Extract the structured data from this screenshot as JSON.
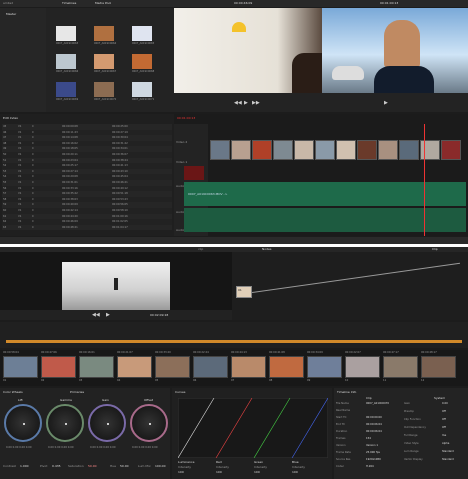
{
  "top": {
    "project_title": "ambs2",
    "tab_timelines": "Timelines",
    "tab_media_pool": "Media Pool",
    "folder_master": "Master",
    "clip_thumbs": [
      {
        "label": "0007_A019C0063",
        "color": "#e7e7e7"
      },
      {
        "label": "0007_A019C0064",
        "color": "#b07040"
      },
      {
        "label": "0007_A019C0065",
        "color": "#dfe4f0"
      },
      {
        "label": "0007_A019C0066",
        "color": "#bcc7cf"
      },
      {
        "label": "0007_A019C0067",
        "color": "#d49a70"
      },
      {
        "label": "0007_A019C0068",
        "color": "#c36a33"
      },
      {
        "label": "0007_A019C0069",
        "color": "#3b4a8a"
      },
      {
        "label": "0007_A019C0070",
        "color": "#8c6c52"
      },
      {
        "label": "0007_A019C0071",
        "color": "#cfd8e1"
      }
    ],
    "viewer_left_tc": "00:00:46:09",
    "viewer_right_tc": "00:01:00:13",
    "edit_index_title": "Edit Index",
    "edit_index_headers": [
      "#",
      "Reel",
      "V",
      "C",
      "Dur",
      "Source In",
      "Source Out",
      "Record In",
      "Record Out"
    ],
    "edit_index_rows": [
      [
        "45",
        "V1",
        "C",
        "00:00:09:08",
        "00:00:25:00"
      ],
      [
        "46",
        "V1",
        "C",
        "00:00:11:23",
        "00:00:27:19"
      ],
      [
        "47",
        "V1",
        "C",
        "00:00:14:08",
        "00:00:30:04"
      ],
      [
        "48",
        "V1",
        "C",
        "00:00:16:02",
        "00:00:31:22"
      ],
      [
        "49",
        "V1",
        "C",
        "00:00:18:05",
        "00:00:34:01"
      ],
      [
        "50",
        "V1",
        "C",
        "00:00:20:11",
        "00:00:36:07"
      ],
      [
        "51",
        "V1",
        "C",
        "00:00:23:04",
        "00:00:38:24"
      ],
      [
        "52",
        "V1",
        "C",
        "00:00:25:17",
        "00:00:41:13"
      ],
      [
        "53",
        "V1",
        "C",
        "00:00:27:14",
        "00:00:43:10"
      ],
      [
        "54",
        "V1",
        "C",
        "00:00:29:08",
        "00:00:45:04"
      ],
      [
        "55",
        "V1",
        "C",
        "00:00:31:01",
        "00:00:46:21"
      ],
      [
        "56",
        "V1",
        "C",
        "00:00:33:16",
        "00:00:49:12"
      ],
      [
        "57",
        "V1",
        "C",
        "00:00:35:22",
        "00:00:51:18"
      ],
      [
        "58",
        "V1",
        "C",
        "00:00:38:03",
        "00:00:53:23"
      ],
      [
        "59",
        "V1",
        "C",
        "00:00:40:09",
        "00:00:56:05"
      ],
      [
        "60",
        "V1",
        "C",
        "00:00:42:14",
        "00:00:58:10"
      ],
      [
        "61",
        "V1",
        "C",
        "00:00:44:20",
        "00:01:00:16"
      ],
      [
        "62",
        "V1",
        "C",
        "00:00:46:09",
        "00:01:02:05"
      ],
      [
        "63",
        "V1",
        "C",
        "00:00:48:21",
        "00:01:04:17"
      ]
    ],
    "timeline_tc": "00:01:00:13",
    "track_video2": "Video 2",
    "track_video1": "Video 1",
    "track_audio1": "Audio 1",
    "track_audio2": "Audio 2",
    "track_audio3": "Audio 3",
    "audio_clip_label": "0007_A019C0063.MOV - L"
  },
  "bottom": {
    "viewer_tc": "00:02:09:18",
    "nodes_title": "Nodes",
    "clip_title": "Clip",
    "node_label": "01",
    "strip_clips": [
      {
        "tc": "00:00:58:04",
        "n": "01",
        "color": "#6d7f96"
      },
      {
        "tc": "00:00:47:06",
        "n": "02",
        "color": "#c05a4a"
      },
      {
        "tc": "00:00:16:01",
        "n": "03",
        "color": "#7a8a80"
      },
      {
        "tc": "00:00:21:07",
        "n": "04",
        "color": "#c89a7a"
      },
      {
        "tc": "00:00:33:20",
        "n": "05",
        "color": "#8c6f5a"
      },
      {
        "tc": "00:00:22:24",
        "n": "06",
        "color": "#5c6a7a"
      },
      {
        "tc": "00:00:44:13",
        "n": "07",
        "color": "#b98a6a"
      },
      {
        "tc": "00:00:41:08",
        "n": "08",
        "color": "#c06a40"
      },
      {
        "tc": "00:00:34:09",
        "n": "09",
        "color": "#6f7f9a"
      },
      {
        "tc": "00:00:22:07",
        "n": "10",
        "color": "#aaa0a0"
      },
      {
        "tc": "00:00:47:17",
        "n": "11",
        "color": "#8a7a6a"
      },
      {
        "tc": "00:00:48:17",
        "n": "12",
        "color": "#7a6050"
      }
    ],
    "color_wheels_title": "Color Wheels",
    "primaries_title": "Primaries",
    "wheels": [
      {
        "label": "Lift",
        "ring": "#5a7aa8"
      },
      {
        "label": "Gamma",
        "ring": "#6a8a6a"
      },
      {
        "label": "Gain",
        "ring": "#7a6aa8"
      },
      {
        "label": "Offset",
        "ring": "#a86a8a"
      }
    ],
    "wheel_values": "0.00  0.00  0.00  0.00",
    "curves_title": "Curves",
    "curve_channels": [
      "Luminance",
      "Red",
      "Green",
      "Blue"
    ],
    "intensity_label": "Intensity",
    "intensity_value": "100",
    "contrast_label": "Contrast",
    "contrast_value": "1.000",
    "pivot_label": "Pivot",
    "pivot_value": "0.435",
    "saturation_label": "Saturation",
    "saturation_value": "50.00",
    "hue_label": "Hue",
    "hue_value": "50.00",
    "lum_mix_label": "Lum Mix",
    "lum_mix_value": "100.00",
    "info_title": "Timeline Info",
    "info_clip_title": "Clip",
    "info_rows": [
      [
        "File Name",
        "0007_A019C0070"
      ],
      [
        "Reel Name",
        ""
      ],
      [
        "Start TC",
        "00:00:00:00"
      ],
      [
        "End TC",
        "00:00:06:04"
      ],
      [
        "Duration",
        "00:00:06:04"
      ],
      [
        "Frames",
        "154"
      ],
      [
        "Version",
        "Version 1"
      ],
      [
        "Frame Rate",
        "25.000 fps"
      ],
      [
        "Source Res",
        "1920x1080"
      ],
      [
        "Codec",
        "H.264"
      ]
    ],
    "system_title": "System",
    "system_rows": [
      [
        "Gain",
        "0.00"
      ],
      [
        "Preamp",
        "Off"
      ],
      [
        "Clip Function",
        "Off"
      ],
      [
        "Out Dependency",
        "Off"
      ],
      [
        "Full Range",
        "Yes"
      ],
      [
        "Video Style",
        "Alpha"
      ],
      [
        "Lum Range",
        "Standard"
      ],
      [
        "Vector Display",
        "Standard"
      ]
    ]
  }
}
